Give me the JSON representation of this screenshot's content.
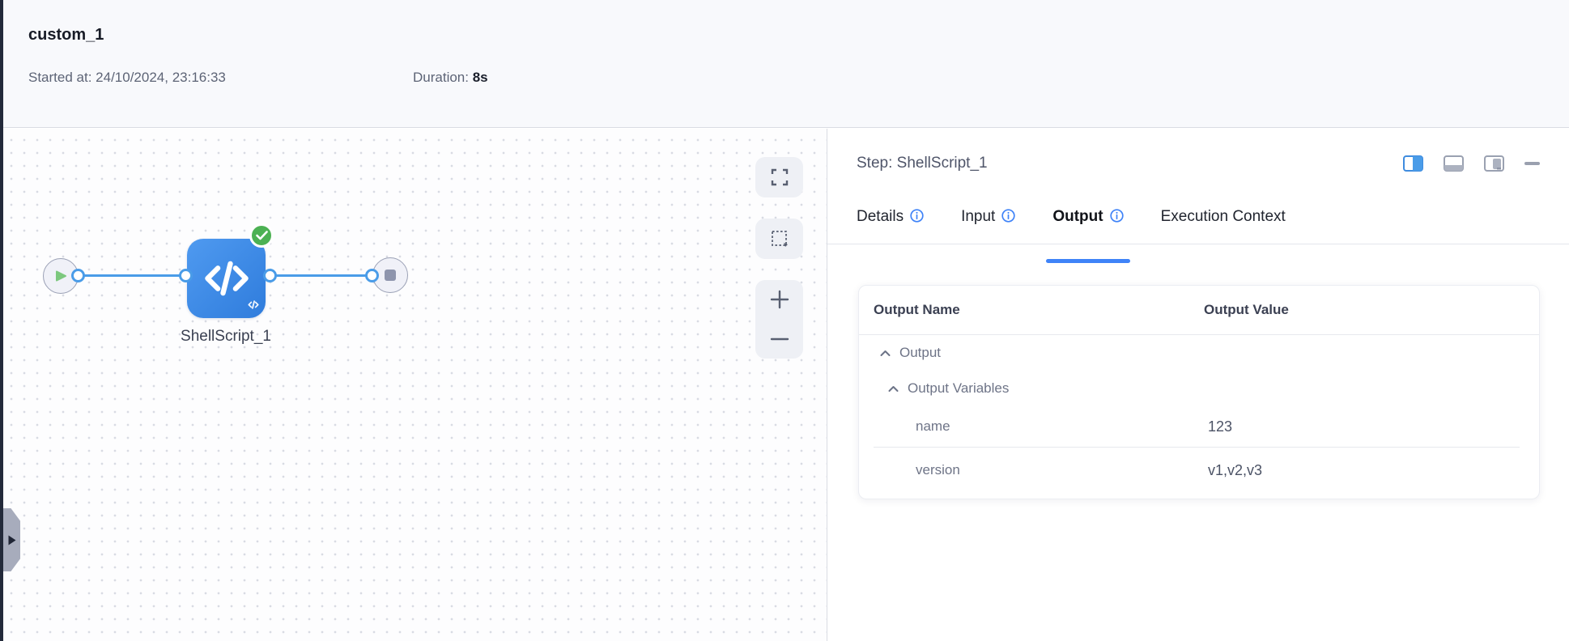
{
  "header": {
    "title": "custom_1",
    "started_label": "Started at:",
    "started_value": "24/10/2024, 23:16:33",
    "duration_label": "Duration:",
    "duration_value": "8s"
  },
  "canvas": {
    "node_label": "ShellScript_1",
    "node_type": "shell-script",
    "node_status": "success",
    "controls": [
      "fit-view",
      "marquee-select",
      "zoom-in",
      "zoom-out"
    ]
  },
  "panel": {
    "title": "Step: ShellScript_1",
    "layout_icons": [
      "split-right-active",
      "split-bottom",
      "drawer-right",
      "minimize"
    ],
    "tabs": [
      {
        "label": "Details",
        "has_info": true,
        "active": false
      },
      {
        "label": "Input",
        "has_info": true,
        "active": false
      },
      {
        "label": "Output",
        "has_info": true,
        "active": true
      },
      {
        "label": "Execution Context",
        "has_info": false,
        "active": false
      }
    ],
    "table": {
      "columns": {
        "name": "Output Name",
        "value": "Output Value"
      },
      "rows": [
        {
          "name": "Output",
          "value": "",
          "kind": "group",
          "expanded": true
        },
        {
          "name": "Output Variables",
          "value": "",
          "kind": "group",
          "expanded": true
        },
        {
          "name": "name",
          "value": "123",
          "kind": "leaf"
        },
        {
          "name": "version",
          "value": "v1,v2,v3",
          "kind": "leaf"
        }
      ]
    }
  },
  "colors": {
    "accent_blue": "#3f83f8",
    "edge_blue": "#4a9ce8",
    "node_blue": "#3d88e6",
    "success_green": "#4cb153",
    "header_bg": "#f8f9fc",
    "sidebar_strip": "#232a3a"
  }
}
